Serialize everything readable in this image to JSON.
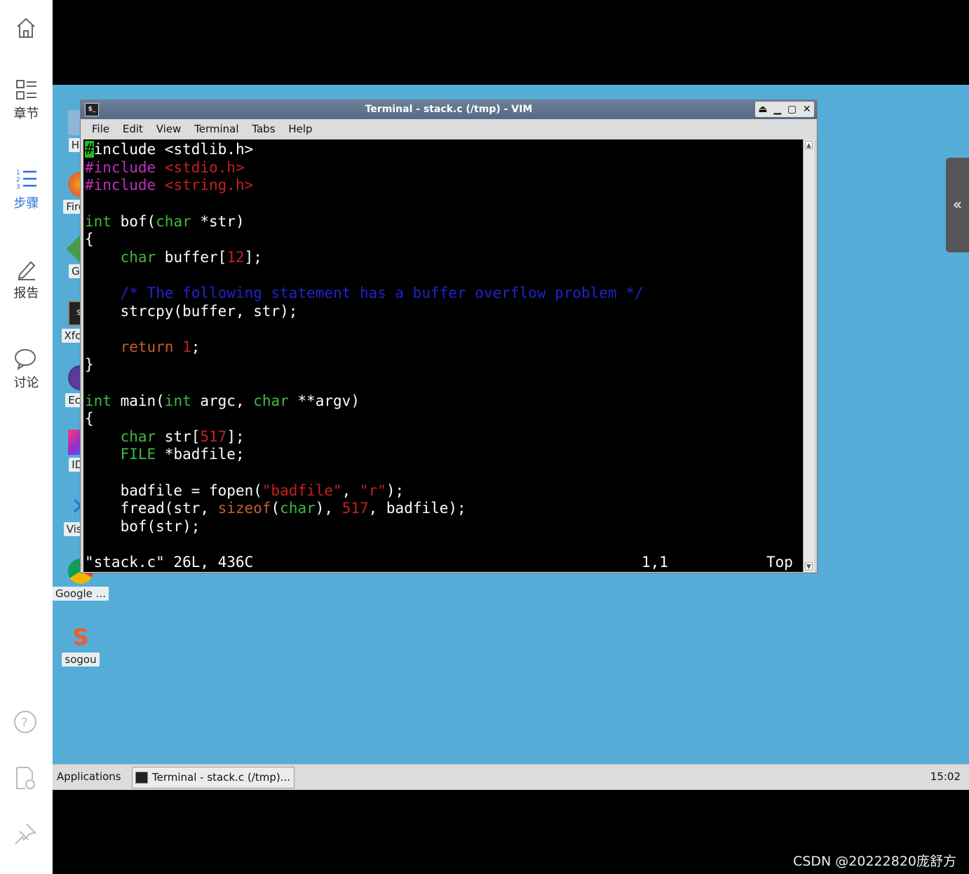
{
  "sidebar": {
    "items": [
      {
        "label": "章节",
        "icon": "list-icon"
      },
      {
        "label": "步骤",
        "icon": "numbered-list-icon"
      },
      {
        "label": "报告",
        "icon": "pencil-icon"
      },
      {
        "label": "讨论",
        "icon": "chat-icon"
      }
    ],
    "active": "步骤"
  },
  "desktop": {
    "icons": [
      {
        "label": "Hor",
        "icon": "home-folder-icon"
      },
      {
        "label": "Firefo",
        "icon": "firefox-icon"
      },
      {
        "label": "GVi",
        "icon": "gvim-icon"
      },
      {
        "label": "Xfce T",
        "icon": "terminal-icon"
      },
      {
        "label": "Eclip",
        "icon": "eclipse-icon"
      },
      {
        "label": "IDE",
        "icon": "intellij-icon"
      },
      {
        "label": "Visua",
        "icon": "vscode-icon"
      },
      {
        "label": "Google ...",
        "icon": "chrome-icon"
      },
      {
        "label": "sogou",
        "icon": "sogou-icon"
      }
    ]
  },
  "window": {
    "title": "Terminal - stack.c (/tmp) - VIM",
    "menu": [
      "File",
      "Edit",
      "View",
      "Terminal",
      "Tabs",
      "Help"
    ],
    "code": {
      "l1": "include <stdlib.h>",
      "l1_cursor": "#",
      "l2_a": "#include ",
      "l2_b": "<stdio.h>",
      "l3_a": "#include ",
      "l3_b": "<string.h>",
      "l5_kw": "int",
      "l5_a": " bof(",
      "l5_kw2": "char",
      "l5_b": " *str)",
      "l6": "{",
      "l7_kw": "char",
      "l7_a": " buffer[",
      "l7_n": "12",
      "l7_b": "];",
      "l9": "/* The following statement has a buffer overflow problem */",
      "l10": "strcpy(buffer, str);",
      "l12_kw": "return",
      "l12_n": "1",
      "l12_b": ";",
      "l13": "}",
      "l15_kw": "int",
      "l15_a": " main(",
      "l15_kw2": "int",
      "l15_b": " argc, ",
      "l15_kw3": "char",
      "l15_c": " **argv)",
      "l16": "{",
      "l17_kw": "char",
      "l17_a": " str[",
      "l17_n": "517",
      "l17_b": "];",
      "l18_kw": "FILE",
      "l18_a": " *badfile;",
      "l20_a": "badfile = fopen(",
      "l20_s1": "\"badfile\"",
      "l20_b": ", ",
      "l20_s2": "\"r\"",
      "l20_c": ");",
      "l21_a": "fread(str, ",
      "l21_kw": "sizeof",
      "l21_b": "(",
      "l21_kw2": "char",
      "l21_c": "), ",
      "l21_n": "517",
      "l21_d": ", badfile);",
      "l22": "bof(str);"
    },
    "status": {
      "file": "\"stack.c\" 26L, 436C",
      "pos": "1,1",
      "scroll": "Top"
    }
  },
  "taskbar": {
    "applications": "Applications",
    "task": "Terminal - stack.c (/tmp)...",
    "clock": "15:02"
  },
  "watermark": "CSDN @20222820庞舒方",
  "colors": {
    "desktop": "#55add7",
    "keyword": "#3dbb3d",
    "preprocessor": "#c22ec2",
    "string": "#c42020",
    "comment": "#2222cc",
    "active_sidebar": "#2b6fd6"
  }
}
